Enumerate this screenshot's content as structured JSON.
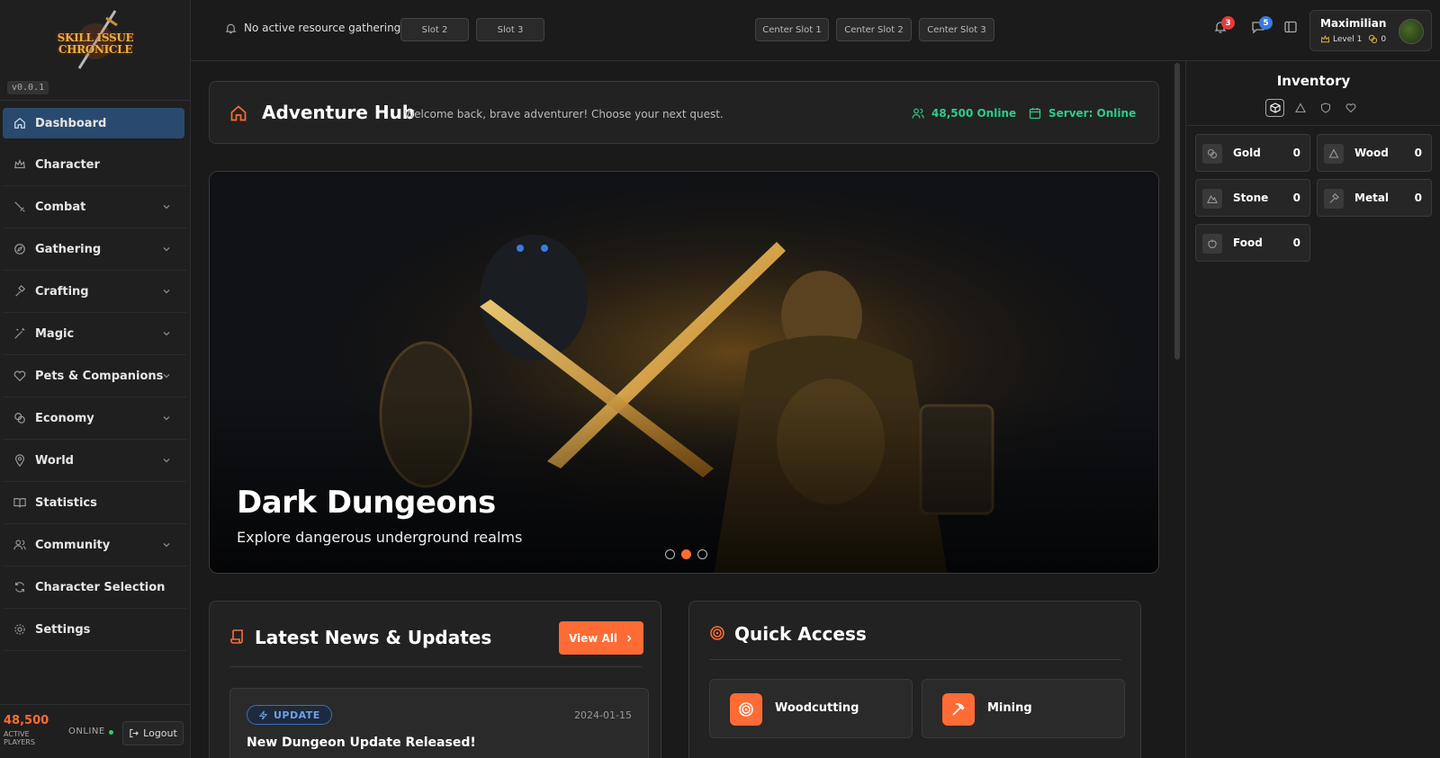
{
  "app": {
    "logo_line1": "SKILL ISSUE",
    "logo_line2": "CHRONICLE",
    "version": "v0.0.1"
  },
  "sidebar": {
    "items": [
      {
        "label": "Dashboard",
        "icon": "home-icon",
        "active": true,
        "expandable": false
      },
      {
        "label": "Character",
        "icon": "crown-icon",
        "expandable": false
      },
      {
        "label": "Combat",
        "icon": "sword-icon",
        "expandable": true
      },
      {
        "label": "Gathering",
        "icon": "compass-icon",
        "expandable": true
      },
      {
        "label": "Crafting",
        "icon": "hammer-icon",
        "expandable": true
      },
      {
        "label": "Magic",
        "icon": "wand-icon",
        "expandable": true
      },
      {
        "label": "Pets & Companions",
        "icon": "heart-icon",
        "expandable": true
      },
      {
        "label": "Economy",
        "icon": "coins-icon",
        "expandable": true
      },
      {
        "label": "World",
        "icon": "map-pin-icon",
        "expandable": true
      },
      {
        "label": "Statistics",
        "icon": "book-icon",
        "expandable": false
      },
      {
        "label": "Community",
        "icon": "users-icon",
        "expandable": true
      },
      {
        "label": "Character Selection",
        "icon": "refresh-icon",
        "expandable": false
      },
      {
        "label": "Settings",
        "icon": "gear-icon",
        "expandable": false
      }
    ],
    "footer": {
      "players_count": "48,500",
      "players_label": "ACTIVE PLAYERS",
      "online_label": "ONLINE",
      "logout_label": "Logout"
    }
  },
  "topbar": {
    "gathering_status": "No active resource gathering",
    "slots": [
      "Slot 2",
      "Slot 3"
    ],
    "center_slots": [
      "Center Slot 1",
      "Center Slot 2",
      "Center Slot 3"
    ],
    "notifications_count": "3",
    "messages_count": "5",
    "user": {
      "name": "Maximilian",
      "level": "Level 1",
      "gold": "0"
    }
  },
  "hub": {
    "title": "Adventure Hub",
    "subtitle": "Welcome back, brave adventurer! Choose your next quest.",
    "online": "48,500 Online",
    "server": "Server: Online"
  },
  "banner": {
    "title": "Dark Dungeons",
    "subtitle": "Explore dangerous underground realms",
    "slides": 3,
    "active_slide": 2
  },
  "news": {
    "title": "Latest News & Updates",
    "view_all": "View All",
    "items": [
      {
        "tag": "UPDATE",
        "date": "2024-01-15",
        "title": "New Dungeon Update Released!"
      }
    ]
  },
  "quick_access": {
    "title": "Quick Access",
    "items": [
      {
        "label": "Woodcutting",
        "icon": "target-icon"
      },
      {
        "label": "Mining",
        "icon": "pickaxe-icon"
      }
    ]
  },
  "inventory": {
    "title": "Inventory",
    "resources": [
      {
        "name": "Gold",
        "value": "0",
        "icon": "coins-icon"
      },
      {
        "name": "Wood",
        "value": "0",
        "icon": "tree-icon"
      },
      {
        "name": "Stone",
        "value": "0",
        "icon": "mountain-icon"
      },
      {
        "name": "Metal",
        "value": "0",
        "icon": "hammer-icon"
      },
      {
        "name": "Food",
        "value": "0",
        "icon": "apple-icon"
      }
    ]
  },
  "colors": {
    "accent": "#ff6b35",
    "active_nav": "#294a6e",
    "online_green": "#2ecc8a",
    "badge_red": "#e5393b",
    "badge_blue": "#3b7be0"
  }
}
